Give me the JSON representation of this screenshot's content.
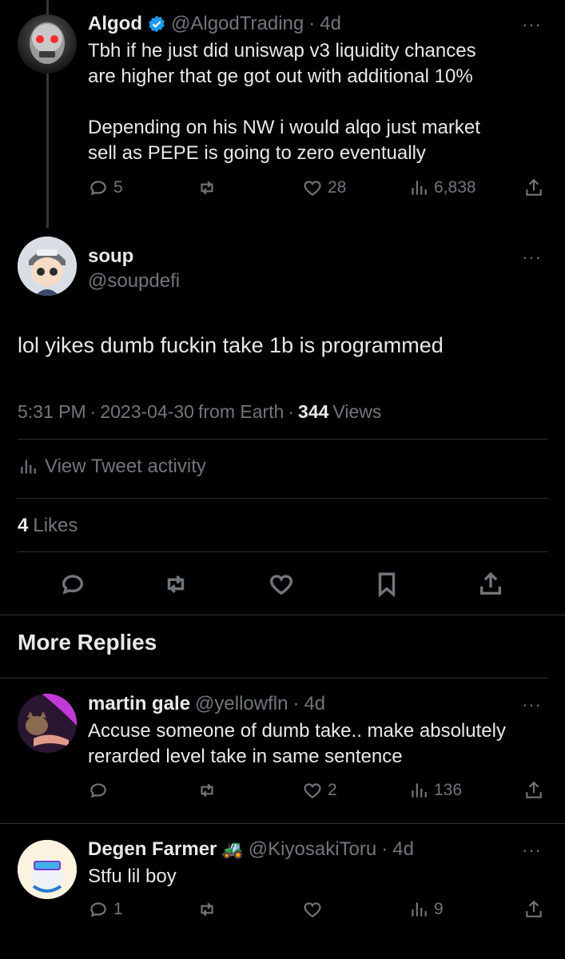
{
  "parent_tweet": {
    "name": "Algod",
    "handle": "@AlgodTrading",
    "time": "4d",
    "text": "Tbh if he just did uniswap v3 liquidity chances\nare higher that ge got out with additional 10%\n\nDepending on his NW i would alqo just market\nsell as PEPE is going to zero eventually",
    "replies": "5",
    "likes": "28",
    "views": "6,838"
  },
  "main_tweet": {
    "name": "soup",
    "handle": "@soupdefi",
    "text": "lol yikes dumb fuckin take 1b is programmed",
    "time": "5:31 PM",
    "date": "2023-04-30",
    "source": "from Earth",
    "views_count": "344",
    "views_label": "Views",
    "activity_label": "View Tweet activity",
    "likes_count": "4",
    "likes_label": "Likes"
  },
  "more_replies_heading": "More Replies",
  "replies": [
    {
      "name": "martin gale",
      "handle": "@yellowfln",
      "time": "4d",
      "text": "Accuse someone of dumb take.. make absolutely\nrerarded level take in same sentence",
      "replies": "",
      "likes": "2",
      "views": "136"
    },
    {
      "name": "Degen Farmer",
      "emoji": "🚜",
      "handle": "@KiyosakiToru",
      "time": "4d",
      "text": "Stfu lil boy",
      "replies": "1",
      "likes": "",
      "views": "9"
    }
  ],
  "separator": "·",
  "colors": {
    "background": "#000000",
    "text": "#e7e9ea",
    "muted": "#71767b",
    "divider": "#2f3336",
    "verified": "#1d9bf0"
  }
}
